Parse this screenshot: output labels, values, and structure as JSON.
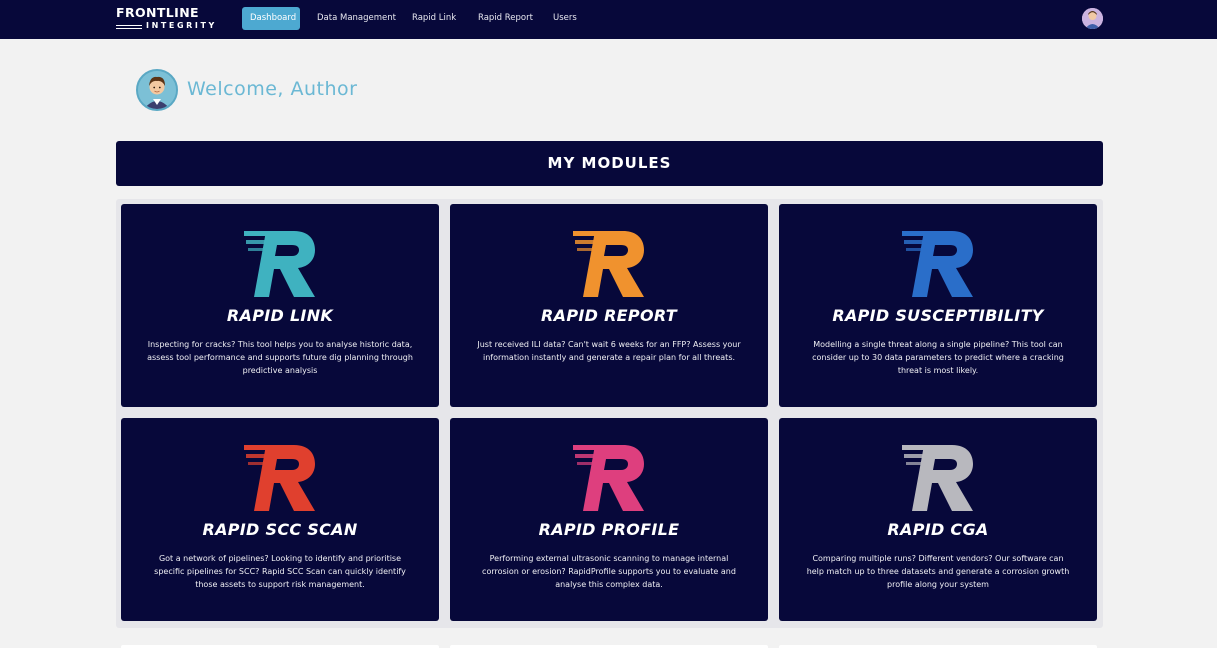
{
  "nav": {
    "logo_line1": "FRONTLINE",
    "logo_line2": "INTEGRITY",
    "items": [
      {
        "label": "Dashboard",
        "active": true
      },
      {
        "label": "Data Management",
        "active": false
      },
      {
        "label": "Rapid Link",
        "active": false
      },
      {
        "label": "Rapid Report",
        "active": false
      },
      {
        "label": "Users",
        "active": false
      }
    ]
  },
  "welcome": {
    "text": "Welcome, Author"
  },
  "modules": {
    "header": "MY MODULES",
    "cards": [
      {
        "title": "RAPID LINK",
        "color": "#3fb2c0",
        "desc": "Inspecting for cracks? This tool helps you to analyse historic data, assess tool performance and supports future dig planning through predictive analysis"
      },
      {
        "title": "RAPID REPORT",
        "color": "#f0922e",
        "desc": "Just received ILI data? Can't wait 6 weeks for an FFP? Assess your information instantly and generate a repair plan for all threats."
      },
      {
        "title": "RAPID SUSCEPTIBILITY",
        "color": "#2a6ec9",
        "desc": "Modelling a single threat along a single pipeline? This tool can consider up to 30 data parameters to predict where a cracking threat is most likely."
      },
      {
        "title": "RAPID SCC SCAN",
        "color": "#e0402e",
        "desc": "Got a network of pipelines? Looking to identify and prioritise specific pipelines for SCC? Rapid SCC Scan can quickly identify those assets to support risk management."
      },
      {
        "title": "RAPID PROFILE",
        "color": "#de3f7e",
        "desc": "Performing external ultrasonic scanning to manage internal corrosion or erosion? RapidProfile supports you to evaluate and analyse this complex data."
      },
      {
        "title": "RAPID CGA",
        "color": "#b8b8be",
        "desc": "Comparing multiple runs? Different vendors? Our software can help match up to three datasets and generate a corrosion growth profile along your system"
      }
    ]
  },
  "icons": {
    "user_avatar": "user-avatar-icon",
    "module_logo": "rapid-r-logo-icon"
  }
}
